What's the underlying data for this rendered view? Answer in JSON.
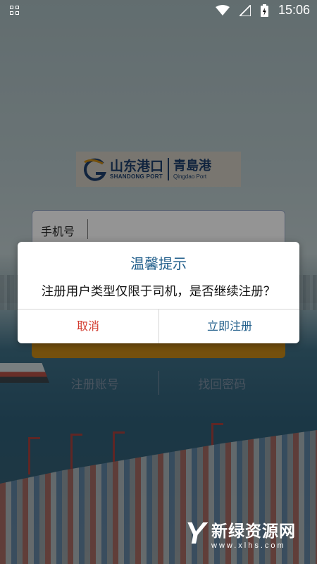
{
  "status_bar": {
    "time": "15:06",
    "icons": [
      "notification-grid-icon",
      "wifi-icon",
      "signal-icon",
      "battery-charging-icon"
    ]
  },
  "logo": {
    "brand_cn": "山东港口",
    "brand_en": "SHANDONG PORT",
    "sub_cn": "青島港",
    "sub_en": "Qingdao Port",
    "color": "#1e3f6b"
  },
  "login": {
    "phone_label": "手机号",
    "register_link": "注册账号",
    "forgot_link": "找回密码",
    "button_color": "#c98a17"
  },
  "dialog": {
    "title": "温馨提示",
    "message": "注册用户类型仅限于司机，是否继续注册？",
    "cancel_label": "取消",
    "confirm_label": "立即注册",
    "cancel_color": "#d23a2e",
    "confirm_color": "#1f5d8a"
  },
  "watermark": {
    "text": "新绿资源网",
    "url": "www.xlhs.com"
  }
}
